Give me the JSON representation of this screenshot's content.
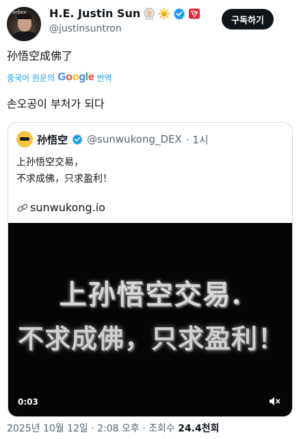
{
  "author": {
    "display_name": "H.E. Justin Sun",
    "handle": "@justinsuntron",
    "avatar_text": "Forbes"
  },
  "subscribe_label": "구독하기",
  "tweet": {
    "text": "孙悟空成佛了",
    "translate_prefix": "중국어 원문의",
    "translate_google": "Google",
    "translate_suffix": "번역",
    "translation": "손오공이 부처가 되다"
  },
  "quote": {
    "name": "孙悟空",
    "handle": "@sunwukong_DEX",
    "time": "· 1시",
    "line1": "上孙悟空交易，",
    "line2": "不求成佛，只求盈利！",
    "link": "sunwukong.io",
    "video": {
      "caption_line1": "上孙悟空交易.",
      "caption_line2": "不求成佛，只求盈利！",
      "time": "0:03"
    }
  },
  "footer": {
    "date": "2025년 10월 12일 · 2:08 오후 · 조회수",
    "views": "24.4천회"
  },
  "colors": {
    "accent": "#1d9bf0",
    "verified": "#1d9bf0",
    "tron_red": "#e8212f",
    "text": "#0f1419",
    "muted": "#536471"
  }
}
